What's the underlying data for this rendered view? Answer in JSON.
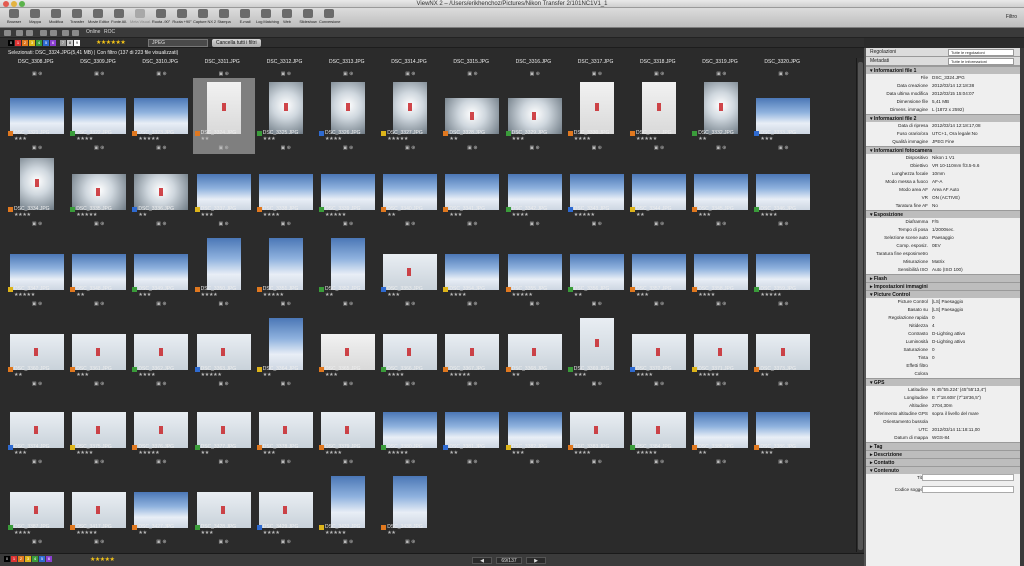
{
  "window": {
    "title": "ViewNX 2 – /Users/erikhenchoz/Pictures/Nikon Transfer 2/101NC1V1_1"
  },
  "toolbar": {
    "items": [
      {
        "label": "Browser",
        "icon": "browser-icon",
        "enabled": true
      },
      {
        "label": "Mappa",
        "icon": "map-icon",
        "enabled": true
      },
      {
        "label": "Modifica",
        "icon": "edit-icon",
        "enabled": true
      },
      {
        "label": "Transfer",
        "icon": "transfer-icon",
        "enabled": true
      },
      {
        "label": "Movie Editor",
        "icon": "movie-editor-icon",
        "enabled": true
      },
      {
        "label": "Fonte All.",
        "icon": "font-icon",
        "enabled": true
      },
      {
        "label": "Meta Visual.",
        "icon": "meta-icon",
        "enabled": false
      },
      {
        "label": "Ruota -90°",
        "icon": "rotate-left-icon",
        "enabled": true
      },
      {
        "label": "Ruota +90°",
        "icon": "rotate-right-icon",
        "enabled": true
      },
      {
        "label": "Capture NX 2",
        "icon": "capture-nx-icon",
        "enabled": true
      },
      {
        "label": "Stampa",
        "icon": "print-icon",
        "enabled": true
      },
      {
        "label": "E-mail",
        "icon": "email-icon",
        "enabled": true
      },
      {
        "label": "Log Matching",
        "icon": "log-matching-icon",
        "enabled": true
      },
      {
        "label": "Web",
        "icon": "web-icon",
        "enabled": true
      },
      {
        "label": "Slideshow",
        "icon": "slideshow-icon",
        "enabled": true
      },
      {
        "label": "Conversione",
        "icon": "convert-icon",
        "enabled": true
      }
    ],
    "filter_label": "Filtro"
  },
  "subtoolbar": {
    "online_label": "Online",
    "online_value": "ROC"
  },
  "filterbar": {
    "format_value": "JPEG",
    "clear_button": "Cancella tutti i filtri"
  },
  "selection_info": "Selezionati: DSC_3324.JPG(5,41 MB) | Con filtro (137 di 223 file visualizzati)",
  "colors": {
    "accent": "#f5c518",
    "label_orange": "#e0781f",
    "panel_bg": "#efefef"
  },
  "grid": {
    "rows": [
      [
        "DSC_3321.JPG",
        "DSC_3322.JPG",
        "DSC_3323.JPG",
        "DSC_3324.JPG",
        "DSC_3325.JPG",
        "DSC_3326.JPG",
        "DSC_3327.JPG",
        "DSC_3328.JPG",
        "DSC_3329.JPG",
        "DSC_3330.JPG",
        "DSC_3331.JPG",
        "DSC_3332.JPG",
        "DSC_3333.JPG"
      ],
      [
        "DSC_3334.JPG",
        "DSC_3335.JPG",
        "DSC_3336.JPG",
        "DSC_3337.JPG",
        "DSC_3338.JPG",
        "DSC_3339.JPG",
        "DSC_3340.JPG",
        "DSC_3341.JPG",
        "DSC_3342.JPG",
        "DSC_3343.JPG",
        "DSC_3344.JPG",
        "DSC_3345.JPG",
        "DSC_3346.JPG"
      ],
      [
        "DSC_3347.JPG",
        "DSC_3348.JPG",
        "DSC_3349.JPG",
        "DSC_3350.JPG",
        "DSC_3351.JPG",
        "DSC_3352.JPG",
        "DSC_3353.JPG",
        "DSC_3354.JPG",
        "DSC_3355.JPG",
        "DSC_3356.JPG",
        "DSC_3357.JPG",
        "DSC_3358.JPG",
        "DSC_3359.JPG"
      ],
      [
        "DSC_3360.JPG",
        "DSC_3361.JPG",
        "DSC_3362.JPG",
        "DSC_3363.JPG",
        "DSC_3364.JPG",
        "DSC_3365.JPG",
        "DSC_3366.JPG",
        "DSC_3367.JPG",
        "DSC_3368.JPG",
        "DSC_3369.JPG",
        "DSC_3370.JPG",
        "DSC_3371.JPG",
        "DSC_3373.JPG"
      ],
      [
        "DSC_3374.JPG",
        "DSC_3375.JPG",
        "DSC_3376.JPG",
        "DSC_3377.JPG",
        "DSC_3378.JPG",
        "DSC_3379.JPG",
        "DSC_3380.JPG",
        "DSC_3381.JPG",
        "DSC_3382.JPG",
        "DSC_3383.JPG",
        "DSC_3384.JPG",
        "DSC_3385.JPG",
        "DSC_3386.JPG"
      ],
      [
        "DSC_3387.JPG",
        "DSC_3417.JPG",
        "DSC_3427.JPG",
        "DSC_3428.JPG",
        "DSC_3429.JPG",
        "DSC_3433.JPG",
        "DSC_3438.JPG"
      ]
    ],
    "top_row": [
      "DSC_3308.JPG",
      "DSC_3309.JPG",
      "DSC_3310.JPG",
      "DSC_3311.JPG",
      "DSC_3312.JPG",
      "DSC_3313.JPG",
      "DSC_3314.JPG",
      "DSC_3315.JPG",
      "DSC_3316.JPG",
      "DSC_3317.JPG",
      "DSC_3318.JPG",
      "DSC_3319.JPG",
      "DSC_3320.JPG"
    ],
    "selected": "DSC_3324.JPG"
  },
  "pager": {
    "value": "69/137"
  },
  "bottom_right": "Nessun processo",
  "panel": {
    "top_label": "Regolazioni",
    "top_dropdown": "Tutte le regolazioni",
    "meta_label": "Metadati",
    "meta_dropdown": "Tutte le informazioni",
    "sections": [
      {
        "title": "Informazioni file 1",
        "rows": [
          {
            "k": "File",
            "v": "DSC_3324.JPG"
          },
          {
            "k": "Data creazione",
            "v": "2012/03/14 12:18:38"
          },
          {
            "k": "Data ultima modifica",
            "v": "2012/03/15 15:04:07"
          },
          {
            "k": "Dimensione file",
            "v": "5,41 MB"
          },
          {
            "k": "Dimens. immagine",
            "v": "L (1872 x 2592)"
          }
        ]
      },
      {
        "title": "Informazioni file 2",
        "rows": [
          {
            "k": "Data di ripresa",
            "v": "2012/03/14 12:18:17,08"
          },
          {
            "k": "Fuso orario/ora",
            "v": "UTC+1, Ora legale:No"
          },
          {
            "k": "Qualità immagine",
            "v": "JPEG Fine"
          }
        ]
      },
      {
        "title": "Informazioni fotocamera",
        "rows": [
          {
            "k": "Dispositivo",
            "v": "Nikon 1 V1"
          },
          {
            "k": "Obiettivo",
            "v": "VR 10-110mm f/3.5-5.6"
          },
          {
            "k": "Lunghezza focale",
            "v": "10mm"
          },
          {
            "k": "Modo messa a fuoco",
            "v": "AF-A"
          },
          {
            "k": "Modo area AF",
            "v": "Area AF Auto"
          },
          {
            "k": "VR",
            "v": "ON (ACTIVE)"
          },
          {
            "k": "Taratura fine AF",
            "v": "No"
          }
        ]
      },
      {
        "title": "Esposizione",
        "rows": [
          {
            "k": "Diaframma",
            "v": "F/5"
          },
          {
            "k": "Tempo di posa",
            "v": "1/2000sec."
          },
          {
            "k": "Selezione scene auto",
            "v": "Paesaggio"
          },
          {
            "k": "Comp. esposiz.",
            "v": "0EV"
          },
          {
            "k": "Taratura fine esposimetro",
            "v": ""
          },
          {
            "k": "Misurazione",
            "v": "Matrix"
          },
          {
            "k": "Sensibilità ISO",
            "v": "Auto (ISO 100)"
          }
        ]
      },
      {
        "title": "Flash",
        "rows": []
      },
      {
        "title": "Impostazioni immagini",
        "rows": []
      },
      {
        "title": "Picture Control",
        "rows": [
          {
            "k": "Picture Control",
            "v": "[LS] Paesaggio"
          },
          {
            "k": "Basato su",
            "v": "[LS] Paesaggio"
          },
          {
            "k": "Regolazione rapida",
            "v": "0"
          },
          {
            "k": "Nitidezza",
            "v": "4"
          },
          {
            "k": "Contrasto",
            "v": "D-Lighting attivo"
          },
          {
            "k": "Luminosità",
            "v": "D-Lighting attivo"
          },
          {
            "k": "Saturazione",
            "v": "0"
          },
          {
            "k": "Tinta",
            "v": "0"
          },
          {
            "k": "Effetti filtro",
            "v": ""
          },
          {
            "k": "Colora",
            "v": ""
          }
        ]
      },
      {
        "title": "GPS",
        "rows": [
          {
            "k": "Latitudine",
            "v": "N 45°55.224' (45°55'13,4\")"
          },
          {
            "k": "Longitudine",
            "v": "E 7°18.608' (7°18'36,5\")"
          },
          {
            "k": "Altitudine",
            "v": "2704,30m"
          },
          {
            "k": "Riferimento altitudine GPS",
            "v": "sopra il livello del mare"
          },
          {
            "k": "Orientamento bussola",
            "v": ""
          },
          {
            "k": "UTC",
            "v": "2012/03/14 11:18:11,00"
          },
          {
            "k": "Datum di mappa",
            "v": "WGS-84"
          }
        ]
      },
      {
        "title": "Tag",
        "rows": []
      },
      {
        "title": "Descrizione",
        "rows": []
      },
      {
        "title": "Contatto",
        "rows": []
      },
      {
        "title": "Contenuto",
        "rows": [
          {
            "k": "Titolo",
            "v": ""
          },
          {
            "k": "Codice soggetto",
            "v": ""
          }
        ]
      }
    ]
  }
}
